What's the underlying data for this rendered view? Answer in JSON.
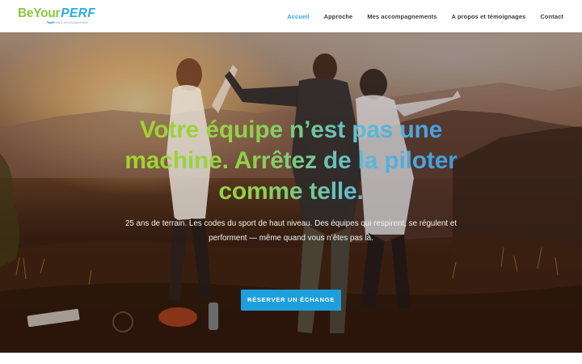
{
  "brand": {
    "logo_be": "Be",
    "logo_your": "Your",
    "logo_perf": "PERF",
    "tagline": "Coaching & accompagnement",
    "colors": {
      "green": "#8cc63f",
      "blue": "#29abe2"
    }
  },
  "nav": {
    "items": [
      {
        "label": "Accueil",
        "active": true
      },
      {
        "label": "Approche",
        "active": false
      },
      {
        "label": "Mes accompagnements",
        "active": false
      },
      {
        "label": "A propos et témoignages",
        "active": false
      },
      {
        "label": "Contact",
        "active": false
      }
    ],
    "active_color": "#29a5de"
  },
  "hero": {
    "title": "Votre équipe n’est pas une machine. Arrêtez de la piloter comme telle.",
    "text": "25 ans de terrain. Les codes du sport de haut niveau. Des équipes qui respirent, se régulent et performent — même quand vous n’êtes pas là.",
    "cta_label": "RÉSERVER UN ÉCHANGE",
    "cta_color": "#1e9fdc",
    "background_image": "group-of-friends-on-hilltop-at-sunset"
  }
}
